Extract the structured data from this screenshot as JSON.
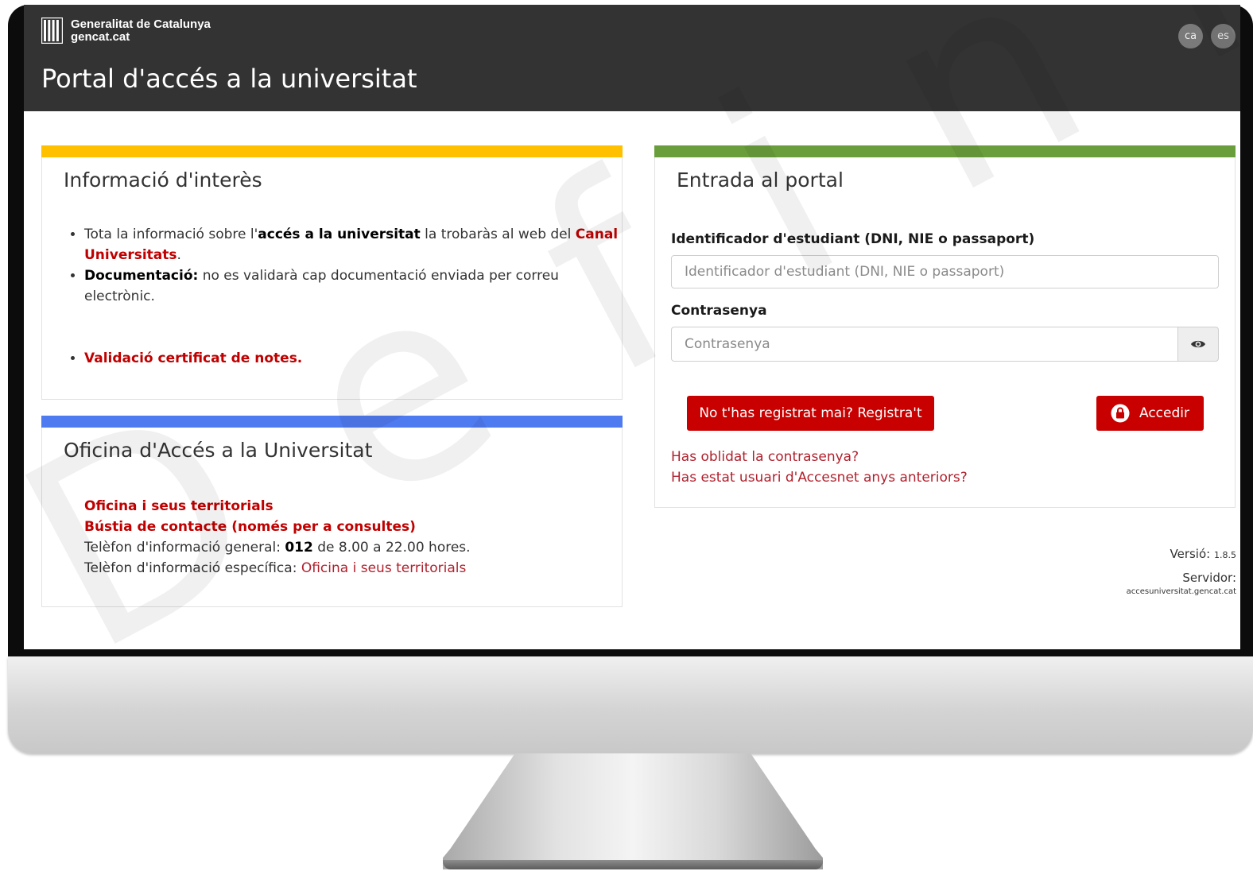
{
  "header": {
    "brand_name": "Generalitat de Catalunya",
    "brand_site": "gencat.cat",
    "title": "Portal d'accés a la universitat",
    "languages": [
      "ca",
      "es"
    ]
  },
  "info_panel": {
    "title": "Informació d'interès",
    "accent_color": "#ffc000",
    "items": {
      "i1_text1": "Tota la informació sobre l'",
      "i1_bold": "accés a la universitat",
      "i1_text2": " la trobaràs al web del ",
      "i1_link": "Canal Universitats",
      "i1_end": ".",
      "i2_bold": "Documentació:",
      "i2_text": " no es validarà cap documentació enviada per correu electrònic.",
      "i3_link": "Validació certificat de notes."
    }
  },
  "office_panel": {
    "title": "Oficina d'Accés a la Universitat",
    "accent_color": "#4f7bf0",
    "link_offices": "Oficina i seus territorials",
    "link_contact": "Bústia de contacte (només per a consultes)",
    "phone_general_prefix": "Telèfon d'informació general: ",
    "phone_general_number": "012",
    "phone_general_suffix": " de 8.00 a 22.00 hores.",
    "phone_specific_prefix": "Telèfon d'informació específica: ",
    "phone_specific_link": "Oficina i seus territorials"
  },
  "login_panel": {
    "title": "Entrada al portal",
    "accent_color": "#6a9e3c",
    "id_label": "Identificador d'estudiant (DNI, NIE o passaport)",
    "id_placeholder": "Identificador d'estudiant (DNI, NIE o passaport)",
    "password_label": "Contrasenya",
    "password_placeholder": "Contrasenya",
    "register_button": "No t'has registrat mai? Registra't",
    "login_button": "Accedir",
    "forgot_link": "Has oblidat la contrasenya?",
    "accesnet_link": "Has estat usuari d'Accesnet anys anteriors?"
  },
  "meta": {
    "version_label": "Versió:",
    "version_value": "1.8.5",
    "server_label": "Servidor:",
    "server_value": "accesuniversitat.gencat.cat"
  },
  "watermark": "Definitiu"
}
